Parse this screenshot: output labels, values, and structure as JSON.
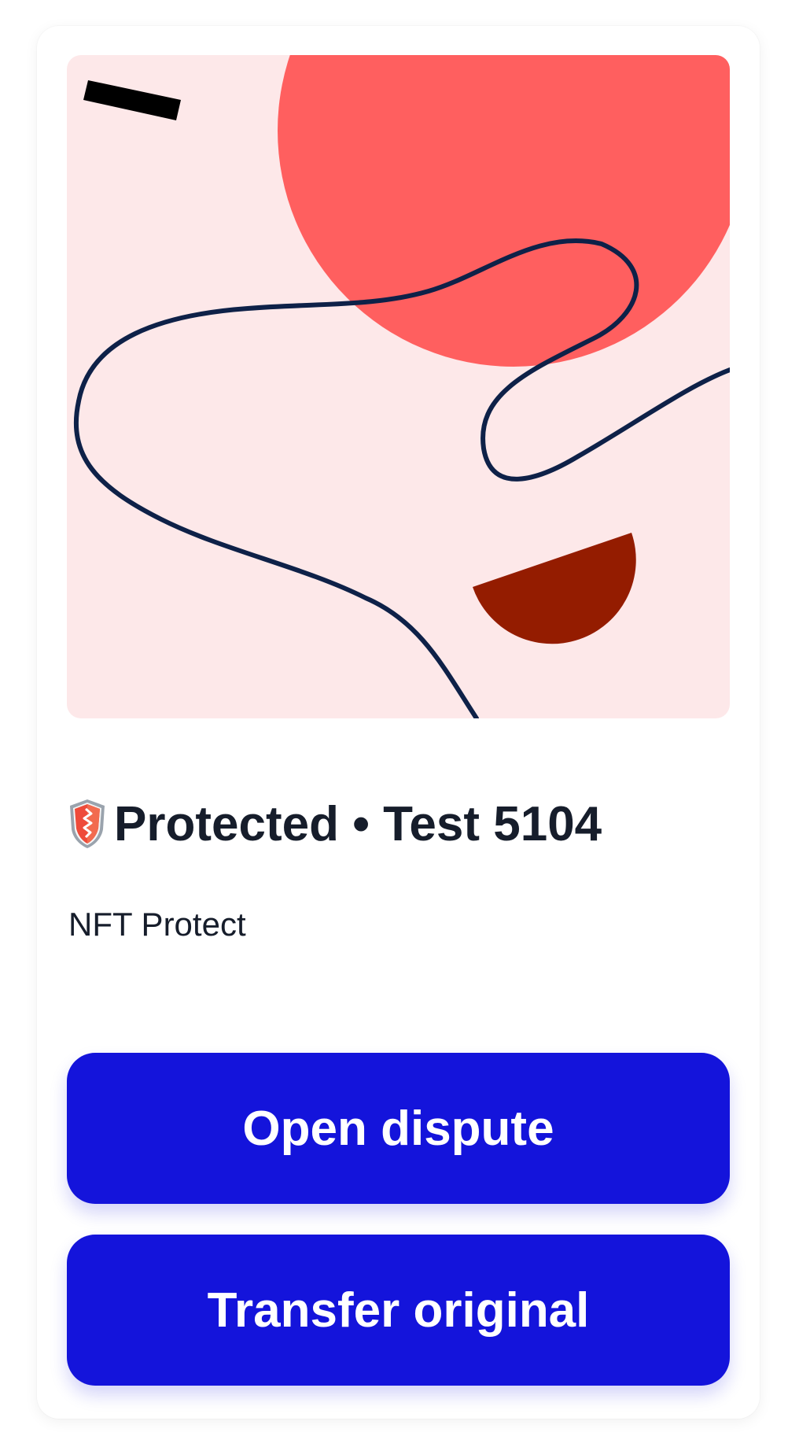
{
  "card": {
    "title": "Protected • Test 5104",
    "collection": "NFT Protect",
    "badge_icon": "shield-icon"
  },
  "actions": {
    "open_dispute_label": "Open dispute",
    "transfer_original_label": "Transfer original"
  },
  "colors": {
    "button_bg": "#1414DB",
    "art_background": "#FDE8E9",
    "art_circle": "#FF5F5F",
    "art_semicircle": "#941C00",
    "art_line": "#0E2148",
    "title_text": "#161D2B"
  }
}
